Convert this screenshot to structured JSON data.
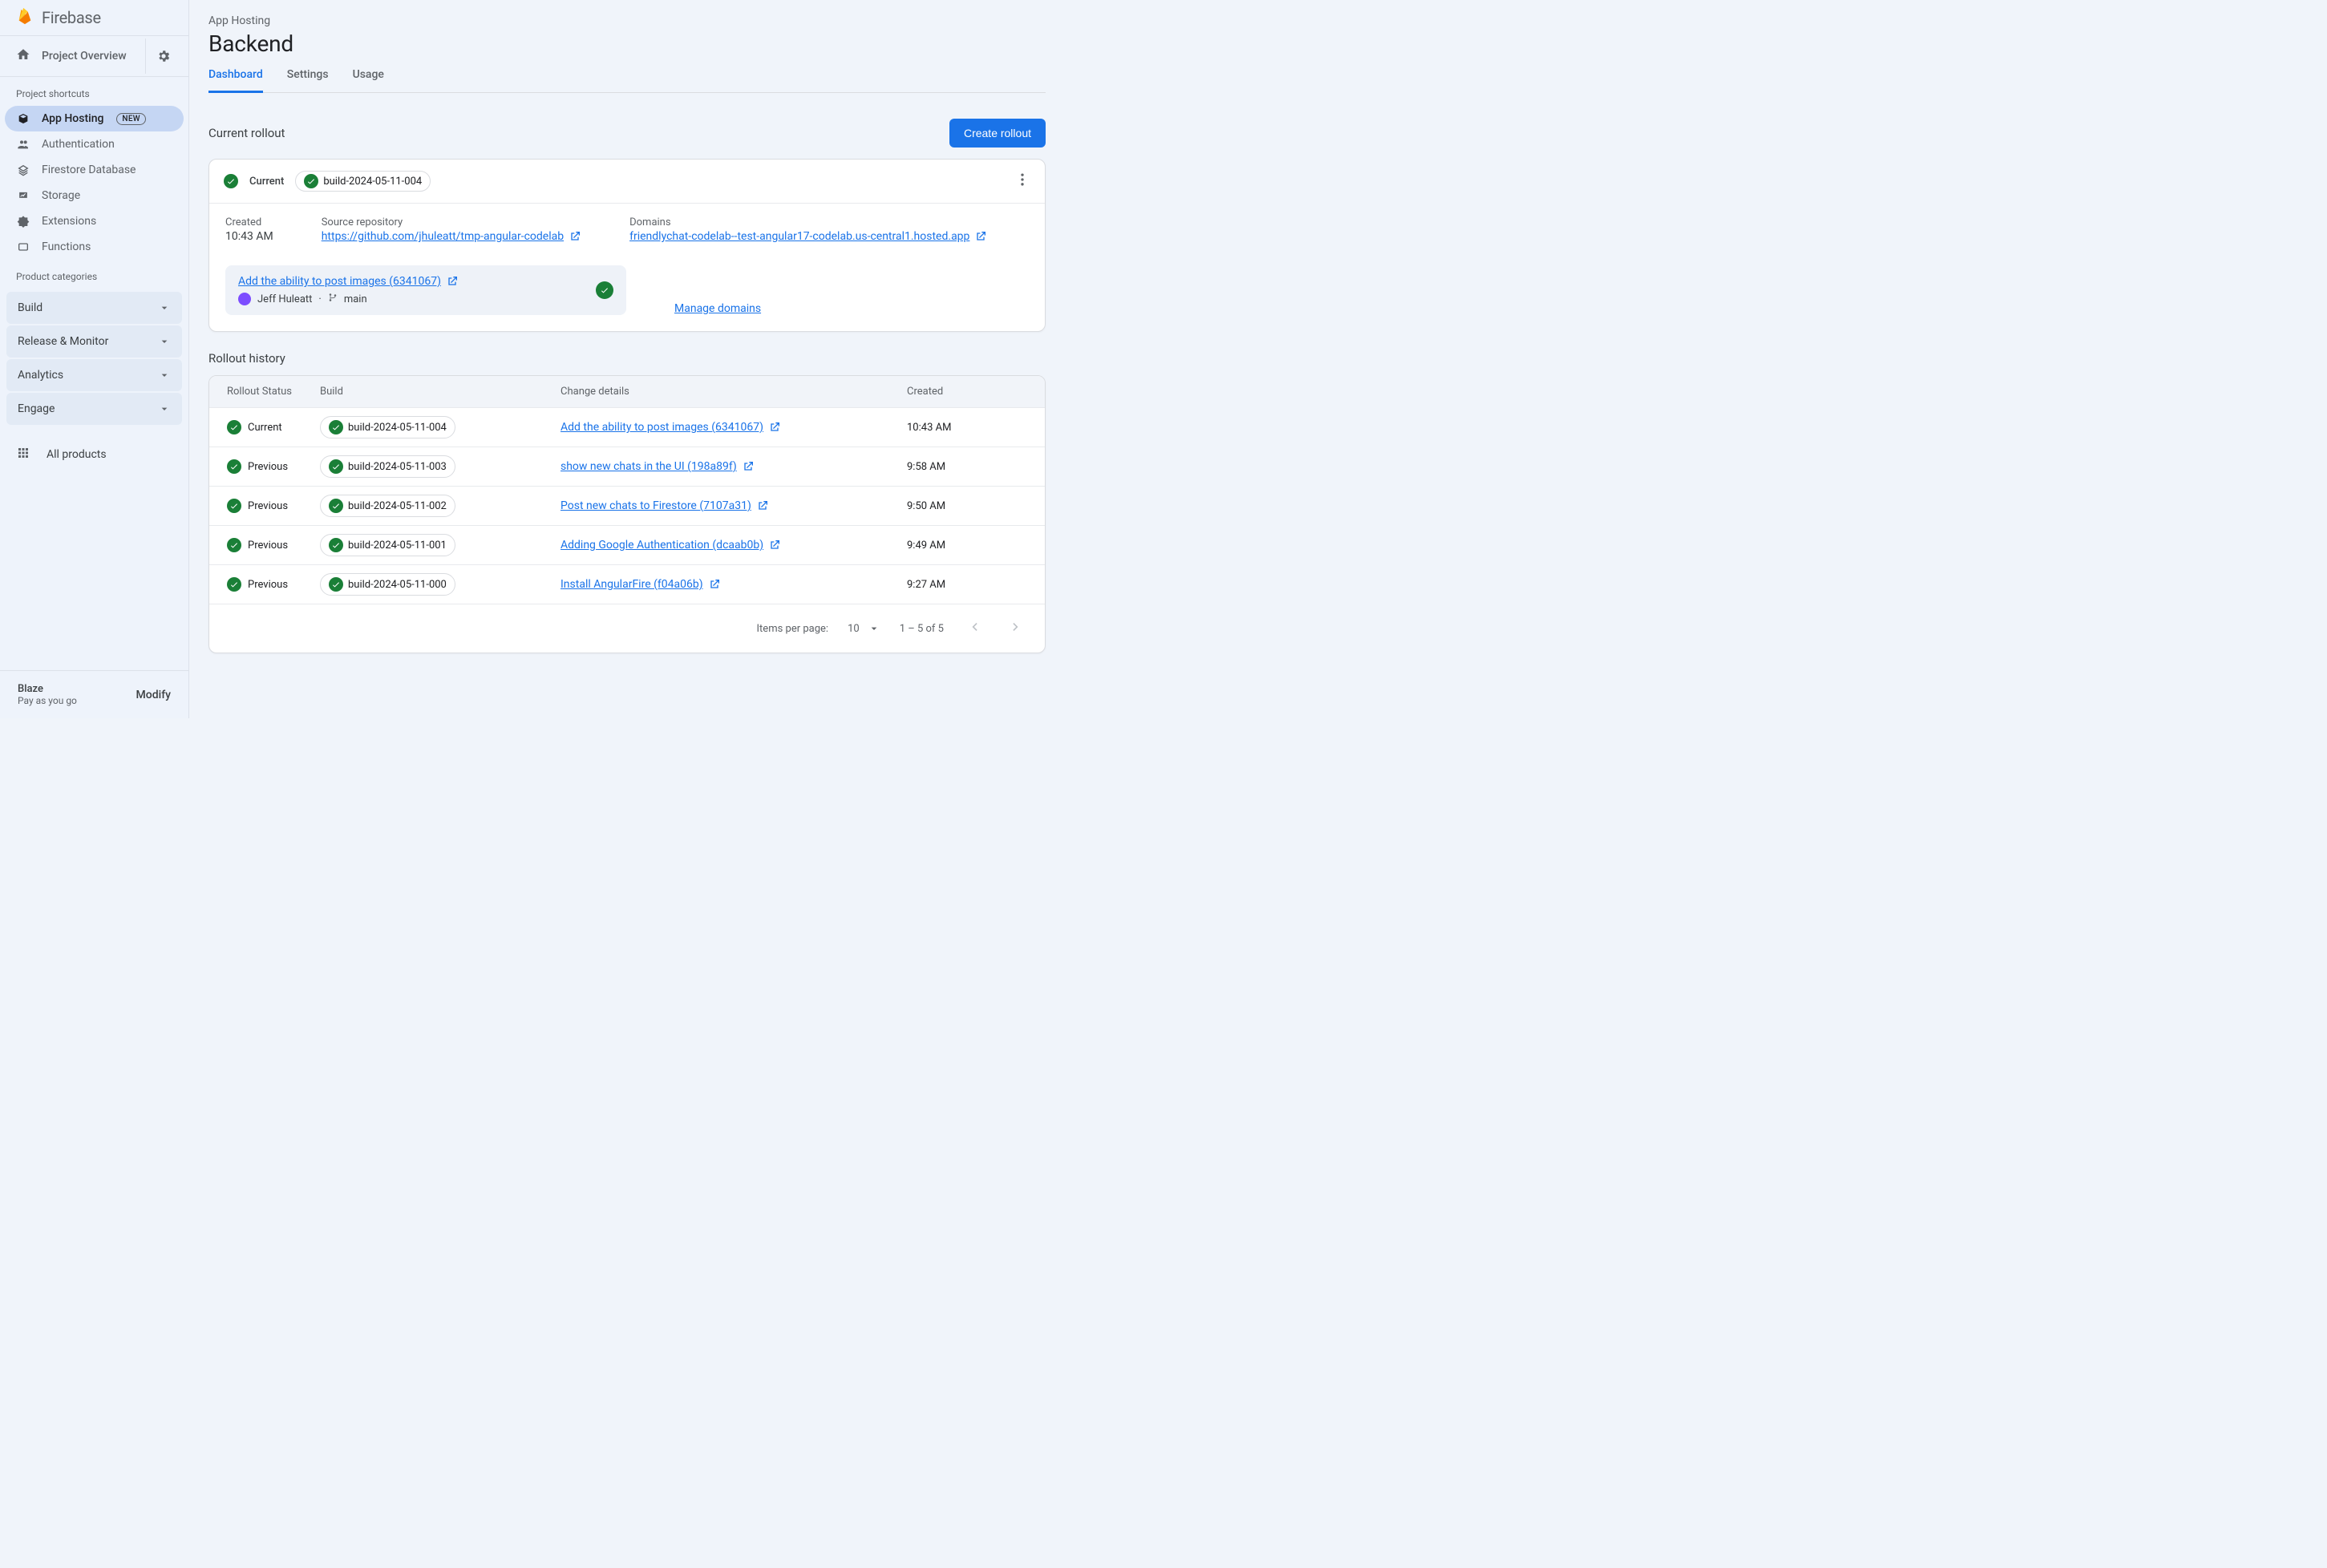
{
  "brand": "Firebase",
  "overview": {
    "label": "Project Overview"
  },
  "sidebar": {
    "shortcuts_label": "Project shortcuts",
    "items": [
      {
        "label": "App Hosting",
        "badge": "NEW",
        "active": true
      },
      {
        "label": "Authentication"
      },
      {
        "label": "Firestore Database"
      },
      {
        "label": "Storage"
      },
      {
        "label": "Extensions"
      },
      {
        "label": "Functions"
      }
    ],
    "categories_label": "Product categories",
    "categories": [
      {
        "label": "Build"
      },
      {
        "label": "Release & Monitor"
      },
      {
        "label": "Analytics"
      },
      {
        "label": "Engage"
      }
    ],
    "all_products": "All products",
    "plan": {
      "name": "Blaze",
      "sub": "Pay as you go",
      "modify": "Modify"
    }
  },
  "breadcrumb": "App Hosting",
  "page_title": "Backend",
  "tabs": [
    {
      "label": "Dashboard",
      "active": true
    },
    {
      "label": "Settings"
    },
    {
      "label": "Usage"
    }
  ],
  "current_section": {
    "title": "Current rollout",
    "cta": "Create rollout"
  },
  "current_rollout": {
    "status": "Current",
    "build": "build-2024-05-11-004",
    "created_label": "Created",
    "created": "10:43 AM",
    "repo_label": "Source repository",
    "repo": "https://github.com/jhuleatt/tmp-angular-codelab",
    "domains_label": "Domains",
    "domain": "friendlychat-codelab--test-angular17-codelab.us-central1.hosted.app",
    "commit_title": "Add the ability to post images (6341067)",
    "author": "Jeff Huleatt",
    "branch": "main",
    "manage_domains": "Manage domains"
  },
  "history": {
    "title": "Rollout history",
    "headers": {
      "status": "Rollout Status",
      "build": "Build",
      "change": "Change details",
      "created": "Created"
    },
    "rows": [
      {
        "status": "Current",
        "build": "build-2024-05-11-004",
        "change": "Add the ability to post images (6341067)",
        "created": "10:43 AM"
      },
      {
        "status": "Previous",
        "build": "build-2024-05-11-003",
        "change": "show new chats in the UI (198a89f)",
        "created": "9:58 AM"
      },
      {
        "status": "Previous",
        "build": "build-2024-05-11-002",
        "change": "Post new chats to Firestore (7107a31)",
        "created": "9:50 AM"
      },
      {
        "status": "Previous",
        "build": "build-2024-05-11-001",
        "change": "Adding Google Authentication (dcaab0b)",
        "created": "9:49 AM"
      },
      {
        "status": "Previous",
        "build": "build-2024-05-11-000",
        "change": "Install AngularFire (f04a06b)",
        "created": "9:27 AM"
      }
    ],
    "pager": {
      "items_label": "Items per page:",
      "size": "10",
      "range": "1 – 5 of 5"
    }
  }
}
